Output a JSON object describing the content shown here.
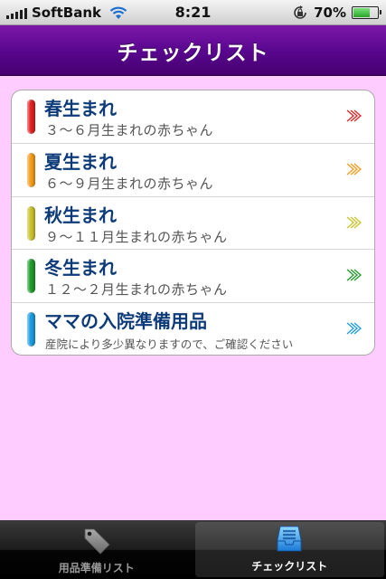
{
  "status_bar": {
    "carrier": "SoftBank",
    "time": "8:21",
    "battery": "70%",
    "battery_level": 0.7
  },
  "nav": {
    "title": "チェックリスト"
  },
  "list": {
    "items": [
      {
        "title": "春生まれ",
        "subtitle": "３〜６月生まれの赤ちゃん",
        "color": "#e02020"
      },
      {
        "title": "夏生まれ",
        "subtitle": "６〜９月生まれの赤ちゃん",
        "color": "#f39a1a"
      },
      {
        "title": "秋生まれ",
        "subtitle": "９〜１１月生まれの赤ちゃん",
        "color": "#c9c12a"
      },
      {
        "title": "冬生まれ",
        "subtitle": "１２〜２月生まれの赤ちゃん",
        "color": "#1e9a2a"
      },
      {
        "title": "ママの入院準備用品",
        "subtitle": "産院により多少異なりますので、ご確認ください",
        "color": "#1a9ae0"
      }
    ]
  },
  "tabs": [
    {
      "label": "用品準備リスト",
      "icon": "tag-icon",
      "selected": false
    },
    {
      "label": "チェックリスト",
      "icon": "inbox-tray-icon",
      "selected": true
    }
  ]
}
